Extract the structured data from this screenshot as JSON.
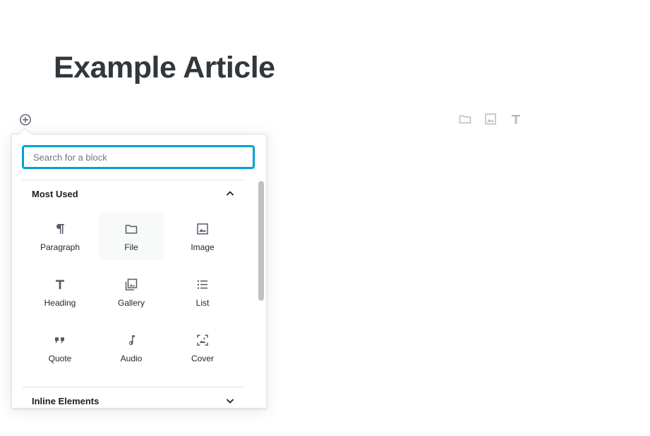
{
  "post": {
    "title": "Example Article"
  },
  "inserter": {
    "toggle_icon": "plus-circle-icon"
  },
  "quick_inserter": [
    {
      "name": "file",
      "icon": "folder-icon"
    },
    {
      "name": "image",
      "icon": "image-icon"
    },
    {
      "name": "heading",
      "icon": "heading-icon"
    }
  ],
  "search": {
    "placeholder": "Search for a block",
    "value": ""
  },
  "panels": {
    "most_used": {
      "title": "Most Used",
      "expanded": true,
      "blocks": [
        {
          "label": "Paragraph",
          "icon": "paragraph-icon"
        },
        {
          "label": "File",
          "icon": "folder-icon",
          "hovered": true
        },
        {
          "label": "Image",
          "icon": "image-icon"
        },
        {
          "label": "Heading",
          "icon": "heading-icon"
        },
        {
          "label": "Gallery",
          "icon": "gallery-icon"
        },
        {
          "label": "List",
          "icon": "list-icon"
        },
        {
          "label": "Quote",
          "icon": "quote-icon"
        },
        {
          "label": "Audio",
          "icon": "audio-icon"
        },
        {
          "label": "Cover",
          "icon": "cover-icon"
        }
      ]
    },
    "inline_elements": {
      "title": "Inline Elements",
      "expanded": false
    }
  },
  "colors": {
    "focus": "#00a0d2",
    "icon": "#555d66",
    "icon_muted": "#b5bcc2"
  }
}
